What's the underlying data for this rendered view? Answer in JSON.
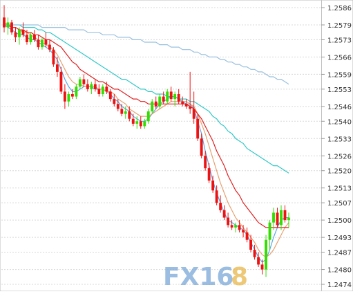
{
  "chart_data": {
    "type": "candlestick",
    "y_ticks": [
      "1.2586",
      "1.2579",
      "1.2573",
      "1.2566",
      "1.2559",
      "1.2553",
      "1.2546",
      "1.2540",
      "1.2533",
      "1.2526",
      "1.2520",
      "1.2513",
      "1.2507",
      "1.2500",
      "1.2493",
      "1.2487",
      "1.2480",
      "1.2474"
    ],
    "ylim": [
      1.2472,
      1.259
    ],
    "grid": true,
    "up_color": "#33dd00",
    "down_color": "#ee1111",
    "candles": [
      [
        1.2582,
        1.2587,
        1.2576,
        1.2578
      ],
      [
        1.2578,
        1.2582,
        1.2575,
        1.258
      ],
      [
        1.258,
        1.2581,
        1.2575,
        1.2576
      ],
      [
        1.2576,
        1.2578,
        1.2572,
        1.2574
      ],
      [
        1.2574,
        1.2578,
        1.2571,
        1.2577
      ],
      [
        1.2577,
        1.258,
        1.2574,
        1.2575
      ],
      [
        1.2575,
        1.2577,
        1.2571,
        1.2572
      ],
      [
        1.2572,
        1.2576,
        1.2571,
        1.2575
      ],
      [
        1.2575,
        1.2577,
        1.2572,
        1.2573
      ],
      [
        1.2573,
        1.2575,
        1.2569,
        1.257
      ],
      [
        1.257,
        1.2574,
        1.2569,
        1.2573
      ],
      [
        1.2573,
        1.2576,
        1.257,
        1.2571
      ],
      [
        1.2571,
        1.2573,
        1.2568,
        1.2569
      ],
      [
        1.2569,
        1.257,
        1.2562,
        1.2563
      ],
      [
        1.2563,
        1.2566,
        1.2558,
        1.256
      ],
      [
        1.256,
        1.2562,
        1.2551,
        1.2552
      ],
      [
        1.2552,
        1.2555,
        1.2545,
        1.2548
      ],
      [
        1.2548,
        1.2552,
        1.2546,
        1.2551
      ],
      [
        1.2551,
        1.2553,
        1.2549,
        1.255
      ],
      [
        1.255,
        1.2555,
        1.2549,
        1.2554
      ],
      [
        1.2554,
        1.2558,
        1.2553,
        1.2557
      ],
      [
        1.2557,
        1.2559,
        1.2554,
        1.2555
      ],
      [
        1.2555,
        1.2557,
        1.2552,
        1.2553
      ],
      [
        1.2553,
        1.2556,
        1.2551,
        1.2555
      ],
      [
        1.2555,
        1.2557,
        1.2552,
        1.2553
      ],
      [
        1.2553,
        1.2555,
        1.255,
        1.2551
      ],
      [
        1.2551,
        1.2555,
        1.255,
        1.2554
      ],
      [
        1.2554,
        1.2556,
        1.2551,
        1.2552
      ],
      [
        1.2552,
        1.2553,
        1.2548,
        1.2549
      ],
      [
        1.2549,
        1.2551,
        1.2546,
        1.2547
      ],
      [
        1.2547,
        1.2549,
        1.2544,
        1.2545
      ],
      [
        1.2545,
        1.2547,
        1.2542,
        1.2543
      ],
      [
        1.2543,
        1.2546,
        1.2541,
        1.2544
      ],
      [
        1.2544,
        1.2546,
        1.254,
        1.2541
      ],
      [
        1.2541,
        1.2543,
        1.2538,
        1.2539
      ],
      [
        1.2539,
        1.2542,
        1.2537,
        1.254
      ],
      [
        1.254,
        1.2542,
        1.2537,
        1.2538
      ],
      [
        1.2538,
        1.2541,
        1.2537,
        1.254
      ],
      [
        1.254,
        1.2545,
        1.2539,
        1.2544
      ],
      [
        1.2544,
        1.2549,
        1.2543,
        1.2548
      ],
      [
        1.2548,
        1.255,
        1.2545,
        1.2546
      ],
      [
        1.2546,
        1.2551,
        1.2545,
        1.255
      ],
      [
        1.255,
        1.2552,
        1.2547,
        1.2548
      ],
      [
        1.2548,
        1.2553,
        1.2547,
        1.2552
      ],
      [
        1.2552,
        1.2554,
        1.2548,
        1.2549
      ],
      [
        1.2549,
        1.2552,
        1.2546,
        1.2551
      ],
      [
        1.2551,
        1.2553,
        1.2547,
        1.2548
      ],
      [
        1.2548,
        1.255,
        1.2546,
        1.2547
      ],
      [
        1.2547,
        1.2549,
        1.2545,
        1.2546
      ],
      [
        1.2546,
        1.256,
        1.2543,
        1.2545
      ],
      [
        1.2545,
        1.2552,
        1.2539,
        1.2541
      ],
      [
        1.2541,
        1.2543,
        1.2532,
        1.2533
      ],
      [
        1.2533,
        1.2535,
        1.2525,
        1.2526
      ],
      [
        1.2526,
        1.2528,
        1.252,
        1.2521
      ],
      [
        1.2521,
        1.2523,
        1.2515,
        1.2516
      ],
      [
        1.2516,
        1.2518,
        1.2511,
        1.2512
      ],
      [
        1.2512,
        1.2514,
        1.2506,
        1.2507
      ],
      [
        1.2507,
        1.251,
        1.2503,
        1.2504
      ],
      [
        1.2504,
        1.2506,
        1.25,
        1.2501
      ],
      [
        1.2501,
        1.2503,
        1.2497,
        1.2498
      ],
      [
        1.2498,
        1.25,
        1.2496,
        1.2497
      ],
      [
        1.2497,
        1.2499,
        1.2495,
        1.2498
      ],
      [
        1.2498,
        1.25,
        1.2495,
        1.2496
      ],
      [
        1.2496,
        1.2498,
        1.2493,
        1.2495
      ],
      [
        1.2495,
        1.2497,
        1.2491,
        1.2492
      ],
      [
        1.2492,
        1.2494,
        1.2487,
        1.2488
      ],
      [
        1.2488,
        1.249,
        1.2484,
        1.2485
      ],
      [
        1.2485,
        1.2487,
        1.2481,
        1.2482
      ],
      [
        1.2482,
        1.2484,
        1.2478,
        1.248
      ],
      [
        1.248,
        1.2494,
        1.2477,
        1.2492
      ],
      [
        1.2492,
        1.25,
        1.2488,
        1.2499
      ],
      [
        1.2499,
        1.2505,
        1.2496,
        1.2503
      ],
      [
        1.2503,
        1.2505,
        1.2497,
        1.2498
      ],
      [
        1.2498,
        1.2506,
        1.2496,
        1.2504
      ],
      [
        1.2504,
        1.2506,
        1.2499,
        1.25
      ],
      [
        1.25,
        1.2503,
        1.2497,
        1.2501
      ]
    ],
    "moving_averages": [
      {
        "color": "#5aa9e6",
        "values": [
          1.2579,
          1.2578,
          1.2577,
          1.2576,
          1.2575,
          1.2575,
          1.2574,
          1.2573,
          1.2573,
          1.2572,
          1.2571,
          1.257,
          1.2569,
          1.2567,
          1.2565,
          1.2561,
          1.2557,
          1.2554,
          1.2552,
          1.2552,
          1.2553,
          1.2554,
          1.2554,
          1.2554,
          1.2553,
          1.2553,
          1.2553,
          1.2552,
          1.2551,
          1.2549,
          1.2548,
          1.2546,
          1.2545,
          1.2544,
          1.2542,
          1.2541,
          1.254,
          1.254,
          1.2541,
          1.2543,
          1.2545,
          1.2547,
          1.2548,
          1.2549,
          1.255,
          1.255,
          1.2549,
          1.2548,
          1.2547,
          1.2547,
          1.2545,
          1.254,
          1.2535,
          1.2528,
          1.2522,
          1.2516,
          1.2511,
          1.2507,
          1.2503,
          1.25,
          1.2499,
          1.2498,
          1.2497,
          1.2496,
          1.2494,
          1.2491,
          1.2488,
          1.2485,
          1.2483,
          1.2484,
          1.2488,
          1.2493,
          1.2497,
          1.25,
          1.2501,
          1.2501
        ]
      },
      {
        "color": "#e8a070",
        "values": [
          1.258,
          1.2579,
          1.2578,
          1.2578,
          1.2577,
          1.2576,
          1.2576,
          1.2575,
          1.2574,
          1.2573,
          1.2572,
          1.2571,
          1.257,
          1.2569,
          1.2567,
          1.2564,
          1.2561,
          1.2558,
          1.2556,
          1.2555,
          1.2555,
          1.2554,
          1.2554,
          1.2554,
          1.2554,
          1.2553,
          1.2553,
          1.2552,
          1.2552,
          1.2551,
          1.2549,
          1.2548,
          1.2547,
          1.2545,
          1.2544,
          1.2543,
          1.2542,
          1.2542,
          1.2542,
          1.2543,
          1.2544,
          1.2545,
          1.2546,
          1.2547,
          1.2548,
          1.2548,
          1.2548,
          1.2548,
          1.2548,
          1.2547,
          1.2546,
          1.2543,
          1.2539,
          1.2535,
          1.253,
          1.2525,
          1.252,
          1.2515,
          1.2511,
          1.2507,
          1.2504,
          1.2501,
          1.2499,
          1.2497,
          1.2495,
          1.2493,
          1.2491,
          1.2488,
          1.2486,
          1.2485,
          1.2486,
          1.2488,
          1.2491,
          1.2494,
          1.2497,
          1.2499
        ]
      },
      {
        "color": "#e02020",
        "values": [
          1.2579,
          1.2579,
          1.2578,
          1.2578,
          1.2577,
          1.2577,
          1.2576,
          1.2576,
          1.2575,
          1.2575,
          1.2574,
          1.2573,
          1.2573,
          1.2572,
          1.2571,
          1.257,
          1.2568,
          1.2566,
          1.2564,
          1.2563,
          1.2561,
          1.256,
          1.2559,
          1.2558,
          1.2557,
          1.2556,
          1.2556,
          1.2555,
          1.2554,
          1.2553,
          1.2553,
          1.2552,
          1.2551,
          1.255,
          1.2549,
          1.2549,
          1.2548,
          1.2548,
          1.2547,
          1.2547,
          1.2547,
          1.2547,
          1.2547,
          1.2547,
          1.2547,
          1.2547,
          1.2547,
          1.2547,
          1.2547,
          1.2546,
          1.2545,
          1.2543,
          1.2541,
          1.2538,
          1.2535,
          1.2532,
          1.2528,
          1.2525,
          1.2522,
          1.2518,
          1.2515,
          1.2512,
          1.251,
          1.2507,
          1.2505,
          1.2503,
          1.2501,
          1.2499,
          1.2498,
          1.2497,
          1.2497,
          1.2497,
          1.2497,
          1.2497,
          1.2497,
          1.2497
        ]
      },
      {
        "color": "#30c8c8",
        "values": [
          1.2579,
          1.2579,
          1.2579,
          1.2579,
          1.2579,
          1.2578,
          1.2578,
          1.2578,
          1.2578,
          1.2577,
          1.2577,
          1.2576,
          1.2576,
          1.2575,
          1.2574,
          1.2573,
          1.2572,
          1.2571,
          1.257,
          1.2569,
          1.2568,
          1.2567,
          1.2566,
          1.2565,
          1.2564,
          1.2563,
          1.2562,
          1.2561,
          1.256,
          1.2559,
          1.2558,
          1.2557,
          1.2557,
          1.2556,
          1.2555,
          1.2554,
          1.2553,
          1.2553,
          1.2552,
          1.2552,
          1.2551,
          1.2551,
          1.2551,
          1.255,
          1.255,
          1.255,
          1.2549,
          1.2549,
          1.2549,
          1.2548,
          1.2548,
          1.2547,
          1.2546,
          1.2545,
          1.2544,
          1.2542,
          1.2541,
          1.2539,
          1.2538,
          1.2536,
          1.2535,
          1.2533,
          1.2532,
          1.2531,
          1.2529,
          1.2528,
          1.2527,
          1.2526,
          1.2525,
          1.2524,
          1.2523,
          1.2522,
          1.2522,
          1.2521,
          1.252,
          1.2519
        ]
      },
      {
        "color": "#98c0e0",
        "values": [
          1.2579,
          1.2579,
          1.2579,
          1.2579,
          1.2579,
          1.2579,
          1.2579,
          1.2579,
          1.2579,
          1.2579,
          1.2578,
          1.2578,
          1.2578,
          1.2578,
          1.2578,
          1.2578,
          1.2578,
          1.2577,
          1.2577,
          1.2577,
          1.2577,
          1.2577,
          1.2576,
          1.2576,
          1.2576,
          1.2576,
          1.2575,
          1.2575,
          1.2575,
          1.2575,
          1.2574,
          1.2574,
          1.2574,
          1.2574,
          1.2573,
          1.2573,
          1.2573,
          1.2572,
          1.2572,
          1.2572,
          1.2572,
          1.2571,
          1.2571,
          1.2571,
          1.257,
          1.257,
          1.257,
          1.2569,
          1.2569,
          1.2569,
          1.2568,
          1.2568,
          1.2567,
          1.2567,
          1.2566,
          1.2566,
          1.2566,
          1.2565,
          1.2565,
          1.2564,
          1.2564,
          1.2563,
          1.2563,
          1.2562,
          1.2562,
          1.2561,
          1.2561,
          1.256,
          1.256,
          1.2559,
          1.2558,
          1.2558,
          1.2557,
          1.2557,
          1.2556,
          1.2555
        ]
      }
    ]
  },
  "watermark": {
    "text_fx": "FX16",
    "text_8": "8",
    "colors": {
      "fx": "#7aa8d8",
      "eight": "#e8b84a"
    }
  }
}
